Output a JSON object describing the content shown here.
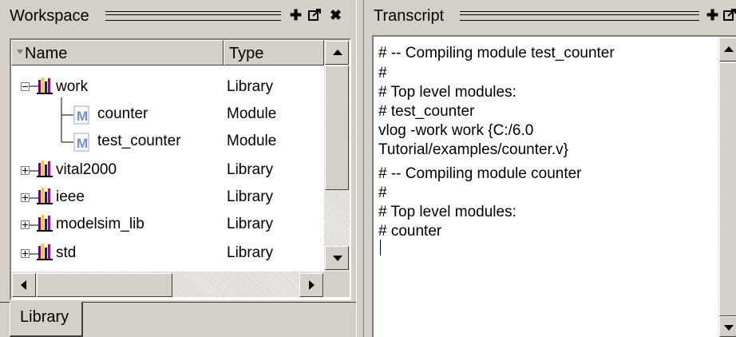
{
  "workspace": {
    "title": "Workspace",
    "columns": {
      "name": "Name",
      "type": "Type"
    },
    "items": [
      {
        "name": "work",
        "type": "Library"
      },
      {
        "name": "counter",
        "type": "Module"
      },
      {
        "name": "test_counter",
        "type": "Module"
      },
      {
        "name": "vital2000",
        "type": "Library"
      },
      {
        "name": "ieee",
        "type": "Library"
      },
      {
        "name": "modelsim_lib",
        "type": "Library"
      },
      {
        "name": "std",
        "type": "Library"
      }
    ],
    "tab": "Library"
  },
  "transcript": {
    "title": "Transcript",
    "lines": [
      "# -- Compiling module test_counter",
      "#",
      "# Top level modules:",
      "#  test_counter",
      "vlog -work work {C:/6.0",
      "Tutorial/examples/counter.v}",
      "# -- Compiling module counter",
      "#",
      "# Top level modules:",
      "#  counter"
    ]
  },
  "colors": {
    "pane_bg": "#d4d0c8",
    "content_bg": "#ffffff",
    "module_icon": "#6f8fd6"
  },
  "icons": [
    "pin-icon",
    "undock-icon",
    "close-icon",
    "library-icon",
    "module-icon",
    "expand-icon",
    "collapse-icon"
  ]
}
